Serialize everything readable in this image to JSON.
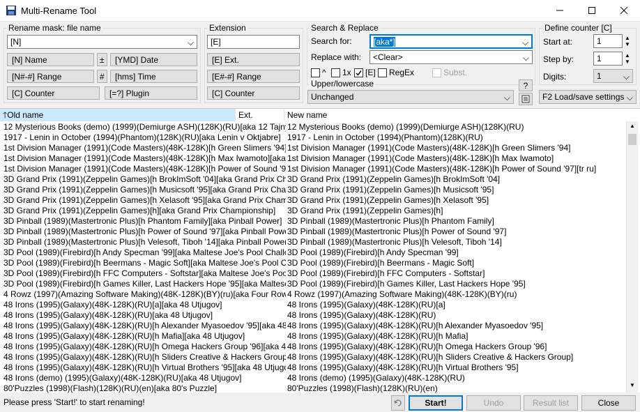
{
  "window": {
    "title": "Multi-Rename Tool"
  },
  "rename_mask": {
    "label": "Rename mask: file name",
    "value": "[N]",
    "buttons": {
      "name": "[N]  Name",
      "plusminus": "±",
      "date": "[YMD]  Date",
      "range": "[N#-#] Range",
      "hash": "#",
      "time": "[hms]  Time",
      "counter": "[C]  Counter",
      "plugin": "[=?]  Plugin"
    }
  },
  "extension": {
    "label": "Extension",
    "value": "[E]",
    "buttons": {
      "ext": "[E]  Ext.",
      "range": "[E#-#] Range",
      "counter": "[C]  Counter"
    }
  },
  "search_replace": {
    "label": "Search & Replace",
    "search_label": "Search for:",
    "search_value": "[aka*]",
    "replace_label": "Replace with:",
    "replace_value": "<Clear>",
    "opt_caret": "^",
    "opt_1x": "1x",
    "opt_e": "[E]",
    "opt_regex": "RegEx",
    "opt_subst": "Subst.",
    "case_label": "Upper/lowercase",
    "case_value": "Unchanged",
    "help": "?"
  },
  "counter": {
    "label": "Define counter [C]",
    "start_label": "Start at:",
    "start_value": "1",
    "step_label": "Step by:",
    "step_value": "1",
    "digits_label": "Digits:",
    "digits_value": "1",
    "load_save": "F2 Load/save settings"
  },
  "columns": {
    "old": "Old name",
    "ext": "Ext.",
    "new": "New name"
  },
  "rows": [
    {
      "old": "12 Mysterious Books (demo) (1999)(Demiurge ASH)(128K)(RU)[aka 12 Tajnyh Knig]",
      "new": "12 Mysterious Books (demo) (1999)(Demiurge ASH)(128K)(RU)"
    },
    {
      "old": "1917 - Lenin in October (1994)(Phantom)(128K)(RU)[aka Lenin v Oktjabre]",
      "new": "1917 - Lenin in October (1994)(Phantom)(128K)(RU)"
    },
    {
      "old": "1st Division Manager (1991)(Code Masters)(48K-128K)[h Green Slimers '94][aka First ...",
      "new": "1st Division Manager (1991)(Code Masters)(48K-128K)[h Green Slimers '94]"
    },
    {
      "old": "1st Division Manager (1991)(Code Masters)(48K-128K)[h Max Iwamoto][aka First Divi...",
      "new": "1st Division Manager (1991)(Code Masters)(48K-128K)[h Max Iwamoto]"
    },
    {
      "old": "1st Division Manager (1991)(Code Masters)(48K-128K)[h Power of Sound '97][tr ru][a...",
      "new": "1st Division Manager (1991)(Code Masters)(48K-128K)[h Power of Sound '97][tr ru]"
    },
    {
      "old": "3D Grand Prix (1991)(Zeppelin Games)[h BrokImSoft '04][aka Grand Prix Championsh...",
      "new": "3D Grand Prix (1991)(Zeppelin Games)[h BrokImSoft '04]"
    },
    {
      "old": "3D Grand Prix (1991)(Zeppelin Games)[h Musicsoft '95][aka Grand Prix Championship]",
      "new": "3D Grand Prix (1991)(Zeppelin Games)[h Musicsoft '95]"
    },
    {
      "old": "3D Grand Prix (1991)(Zeppelin Games)[h Xelasoft '95][aka Grand Prix Championship]",
      "new": "3D Grand Prix (1991)(Zeppelin Games)[h Xelasoft '95]"
    },
    {
      "old": "3D Grand Prix (1991)(Zeppelin Games)[h][aka Grand Prix Championship]",
      "new": "3D Grand Prix (1991)(Zeppelin Games)[h]"
    },
    {
      "old": "3D Pinball (1989)(Mastertronic Plus)[h Phantom Family][aka Pinball Power]",
      "new": "3D Pinball (1989)(Mastertronic Plus)[h Phantom Family]"
    },
    {
      "old": "3D Pinball (1989)(Mastertronic Plus)[h Power of Sound '97][aka Pinball Power]",
      "new": "3D Pinball (1989)(Mastertronic Plus)[h Power of Sound '97]"
    },
    {
      "old": "3D Pinball (1989)(Mastertronic Plus)[h Velesoft, Tiboh '14][aka Pinball Power]",
      "new": "3D Pinball (1989)(Mastertronic Plus)[h Velesoft, Tiboh '14]"
    },
    {
      "old": "3D Pool (1989)(Firebird)[h Andy Specman '99][aka Maltese Joe's Pool Challenge]",
      "new": "3D Pool (1989)(Firebird)[h Andy Specman '99]"
    },
    {
      "old": "3D Pool (1989)(Firebird)[h Beermans - Magic Soft][aka Maltese Joe's Pool Challenge]",
      "new": "3D Pool (1989)(Firebird)[h Beermans - Magic Soft]"
    },
    {
      "old": "3D Pool (1989)(Firebird)[h FFC Computers - Softstar][aka Maltese Joe's Pool Challe...",
      "new": "3D Pool (1989)(Firebird)[h FFC Computers - Softstar]"
    },
    {
      "old": "3D Pool (1989)(Firebird)[h Games Killer, Last Hackers Hope '95][aka Maltese Joe's P...",
      "new": "3D Pool (1989)(Firebird)[h Games Killer, Last Hackers Hope '95]"
    },
    {
      "old": "4 Rowz (1997)(Amazing Software Making)(48K-128K)(BY)(ru)[aka Four Row's Pasya...",
      "new": "4 Rowz (1997)(Amazing Software Making)(48K-128K)(BY)(ru)"
    },
    {
      "old": "48 Irons (1995)(Galaxy)(48K-128K)(RU)[a][aka 48 Utjugov]",
      "new": "48 Irons (1995)(Galaxy)(48K-128K)(RU)[a]"
    },
    {
      "old": "48 Irons (1995)(Galaxy)(48K-128K)(RU)[aka 48 Utjugov]",
      "new": "48 Irons (1995)(Galaxy)(48K-128K)(RU)"
    },
    {
      "old": "48 Irons (1995)(Galaxy)(48K-128K)(RU)[h Alexander Myasoedov '95][aka 48 Utjugov]",
      "new": "48 Irons (1995)(Galaxy)(48K-128K)(RU)[h Alexander Myasoedov '95]"
    },
    {
      "old": "48 Irons (1995)(Galaxy)(48K-128K)(RU)[h Mafia][aka 48 Utjugov]",
      "new": "48 Irons (1995)(Galaxy)(48K-128K)(RU)[h Mafia]"
    },
    {
      "old": "48 Irons (1995)(Galaxy)(48K-128K)(RU)[h Omega Hackers Group '96][aka 48 Utjugov]",
      "new": "48 Irons (1995)(Galaxy)(48K-128K)(RU)[h Omega Hackers Group '96]"
    },
    {
      "old": "48 Irons (1995)(Galaxy)(48K-128K)(RU)[h Sliders Creative & Hackers Group][aka 48 ...",
      "new": "48 Irons (1995)(Galaxy)(48K-128K)(RU)[h Sliders Creative & Hackers Group]"
    },
    {
      "old": "48 Irons (1995)(Galaxy)(48K-128K)(RU)[h Virtual Brothers '95][aka 48 Utjugov]",
      "new": "48 Irons (1995)(Galaxy)(48K-128K)(RU)[h Virtual Brothers '95]"
    },
    {
      "old": "48 Irons (demo) (1995)(Galaxy)(48K-128K)(RU)[aka 48 Utjugov]",
      "new": "48 Irons (demo) (1995)(Galaxy)(48K-128K)(RU)"
    },
    {
      "old": "80'Puzzles (1998)(Flash)(128K)(RU)(en)[aka 80's Puzzle]",
      "new": "80'Puzzles (1998)(Flash)(128K)(RU)(en)"
    }
  ],
  "status": {
    "message": "Please press 'Start!' to start renaming!",
    "start": "Start!",
    "undo": "Undo",
    "result": "Result list",
    "close": "Close"
  }
}
